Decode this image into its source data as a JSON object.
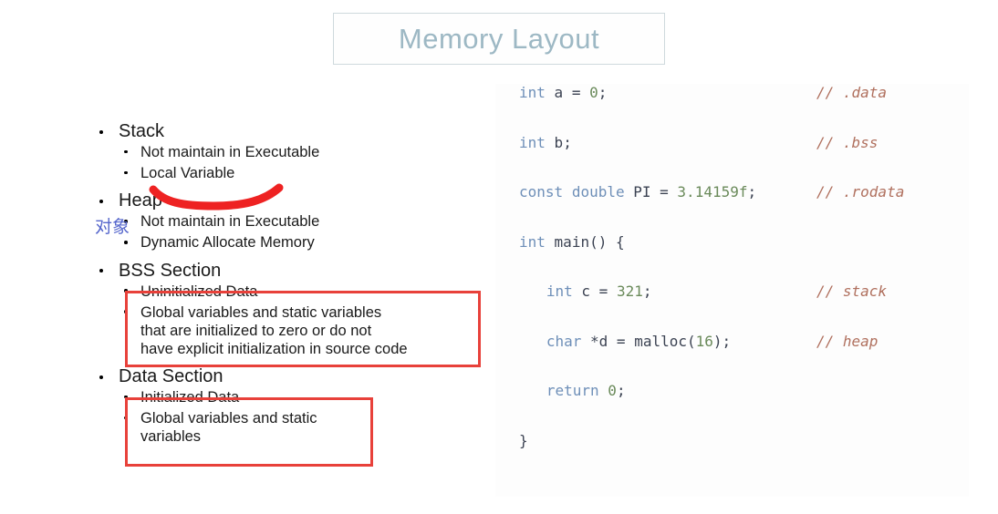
{
  "title": {
    "text": "Memory Layout",
    "border_color": "#cfd9dd",
    "text_color": "#9db8c4"
  },
  "annotations": {
    "cjk_note": "对象",
    "cjk_note_color": "#5566cc",
    "highlight_color": "#e8413a",
    "underline_color": "#ee2222"
  },
  "outline": {
    "sections": [
      {
        "title": "Stack",
        "items": [
          "Not maintain in Executable",
          "Local Variable"
        ]
      },
      {
        "title": "Heap",
        "items": [
          "Not maintain in Executable",
          "Dynamic Allocate Memory"
        ]
      },
      {
        "title": "BSS Section",
        "items": [
          "Uninitialized Data",
          "Global variables and static variables\nthat are initialized to zero or do not\nhave explicit initialization in source code"
        ]
      },
      {
        "title": "Data Section",
        "items": [
          "Initialized Data",
          "Global variables and static\nvariables"
        ]
      }
    ]
  },
  "code": {
    "language": "c",
    "lines": [
      {
        "tokens": [
          {
            "t": "int",
            "c": "kw"
          },
          {
            "t": " ",
            "c": "pun"
          },
          {
            "t": "a",
            "c": "id"
          },
          {
            "t": " = ",
            "c": "pun"
          },
          {
            "t": "0",
            "c": "num"
          },
          {
            "t": ";",
            "c": "pun"
          }
        ],
        "indent": 0,
        "comment": "// .data"
      },
      {
        "tokens": [
          {
            "t": "int",
            "c": "kw"
          },
          {
            "t": " ",
            "c": "pun"
          },
          {
            "t": "b",
            "c": "id"
          },
          {
            "t": ";",
            "c": "pun"
          }
        ],
        "indent": 0,
        "comment": "// .bss"
      },
      {
        "tokens": [
          {
            "t": "const",
            "c": "kw"
          },
          {
            "t": " ",
            "c": "pun"
          },
          {
            "t": "double",
            "c": "kw"
          },
          {
            "t": " ",
            "c": "pun"
          },
          {
            "t": "PI",
            "c": "id"
          },
          {
            "t": " = ",
            "c": "pun"
          },
          {
            "t": "3.14159f",
            "c": "num"
          },
          {
            "t": ";",
            "c": "pun"
          }
        ],
        "indent": 0,
        "comment": "// .rodata"
      },
      {
        "tokens": [
          {
            "t": "int",
            "c": "kw"
          },
          {
            "t": " ",
            "c": "pun"
          },
          {
            "t": "main",
            "c": "id"
          },
          {
            "t": "() {",
            "c": "pun"
          }
        ],
        "indent": 0,
        "comment": ""
      },
      {
        "tokens": [
          {
            "t": "int",
            "c": "kw"
          },
          {
            "t": " ",
            "c": "pun"
          },
          {
            "t": "c",
            "c": "id"
          },
          {
            "t": " = ",
            "c": "pun"
          },
          {
            "t": "321",
            "c": "num"
          },
          {
            "t": ";",
            "c": "pun"
          }
        ],
        "indent": 1,
        "comment": "// stack"
      },
      {
        "tokens": [
          {
            "t": "char",
            "c": "kw"
          },
          {
            "t": " *",
            "c": "pun"
          },
          {
            "t": "d",
            "c": "id"
          },
          {
            "t": " = ",
            "c": "pun"
          },
          {
            "t": "malloc",
            "c": "id"
          },
          {
            "t": "(",
            "c": "pun"
          },
          {
            "t": "16",
            "c": "num"
          },
          {
            "t": ");",
            "c": "pun"
          }
        ],
        "indent": 1,
        "comment": "// heap"
      },
      {
        "tokens": [
          {
            "t": "return",
            "c": "kw"
          },
          {
            "t": " ",
            "c": "pun"
          },
          {
            "t": "0",
            "c": "num"
          },
          {
            "t": ";",
            "c": "pun"
          }
        ],
        "indent": 1,
        "comment": ""
      },
      {
        "tokens": [
          {
            "t": "}",
            "c": "pun"
          }
        ],
        "indent": 0,
        "comment": ""
      }
    ]
  }
}
